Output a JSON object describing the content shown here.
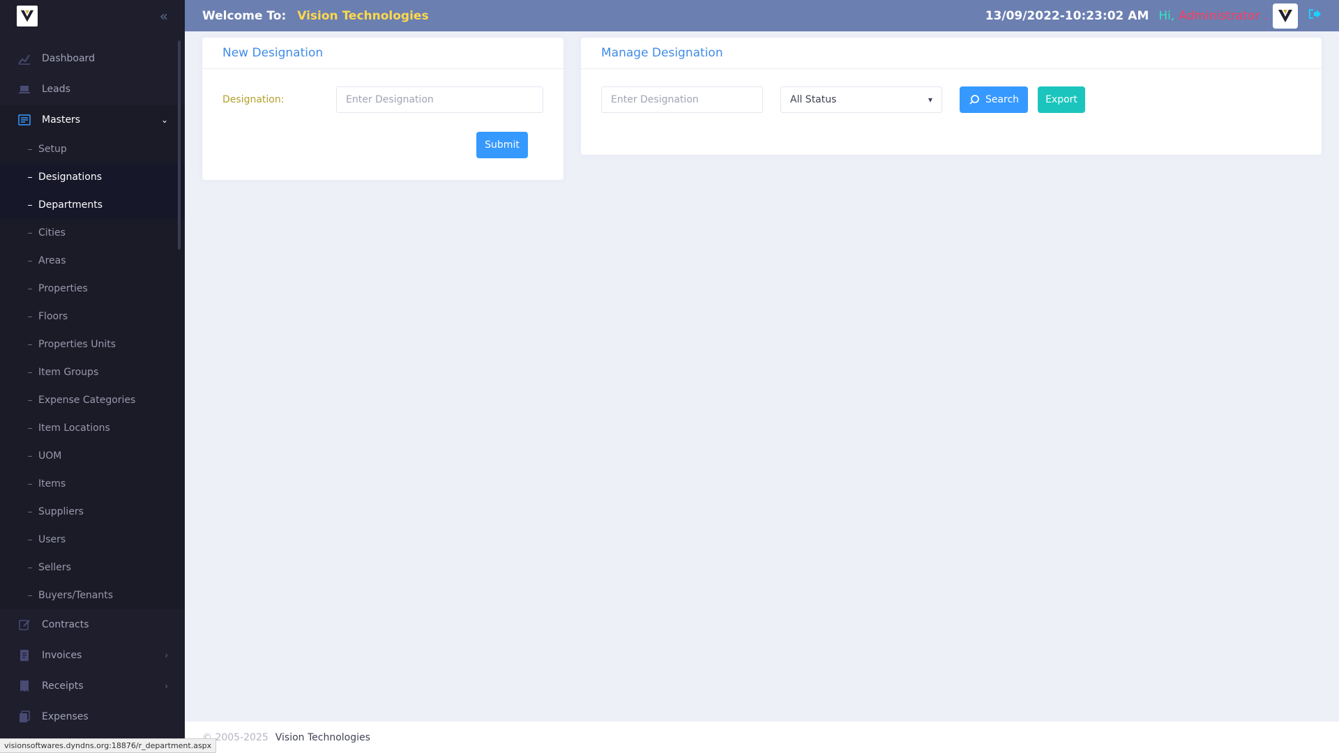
{
  "sidebar": {
    "items": [
      {
        "label": "Dashboard"
      },
      {
        "label": "Leads"
      },
      {
        "label": "Masters"
      }
    ],
    "masters_sub": [
      {
        "label": "Setup"
      },
      {
        "label": "Designations"
      },
      {
        "label": "Departments"
      },
      {
        "label": "Cities"
      },
      {
        "label": "Areas"
      },
      {
        "label": "Properties"
      },
      {
        "label": "Floors"
      },
      {
        "label": "Properties Units"
      },
      {
        "label": "Item Groups"
      },
      {
        "label": "Expense Categories"
      },
      {
        "label": "Item Locations"
      },
      {
        "label": "UOM"
      },
      {
        "label": "Items"
      },
      {
        "label": "Suppliers"
      },
      {
        "label": "Users"
      },
      {
        "label": "Sellers"
      },
      {
        "label": "Buyers/Tenants"
      }
    ],
    "bottom_items": [
      {
        "label": "Contracts"
      },
      {
        "label": "Invoices"
      },
      {
        "label": "Receipts"
      },
      {
        "label": "Expenses"
      }
    ]
  },
  "header": {
    "welcome": "Welcome To:",
    "company": "Vision Technologies",
    "datetime": "13/09/2022-10:23:02 AM",
    "hi": "Hi,",
    "user": "Administrator ."
  },
  "new_designation": {
    "title": "New Designation",
    "label": "Designation:",
    "placeholder": "Enter Designation",
    "submit": "Submit"
  },
  "manage_designation": {
    "title": "Manage Designation",
    "placeholder": "Enter Designation",
    "status": "All Status",
    "search": "Search",
    "export": "Export"
  },
  "footer": {
    "copyright": "© 2005-2025",
    "company": "Vision Technologies"
  },
  "statusbar": {
    "url": "visionsoftwares.dyndns.org:18876/r_department.aspx"
  },
  "colors": {
    "sidebar_bg": "#1e1e2d",
    "header_bg": "#6b7fb1",
    "accent": "#3699ff",
    "export": "#1bc5bd",
    "company": "#ffd84d",
    "admin": "#ff3b5c"
  }
}
